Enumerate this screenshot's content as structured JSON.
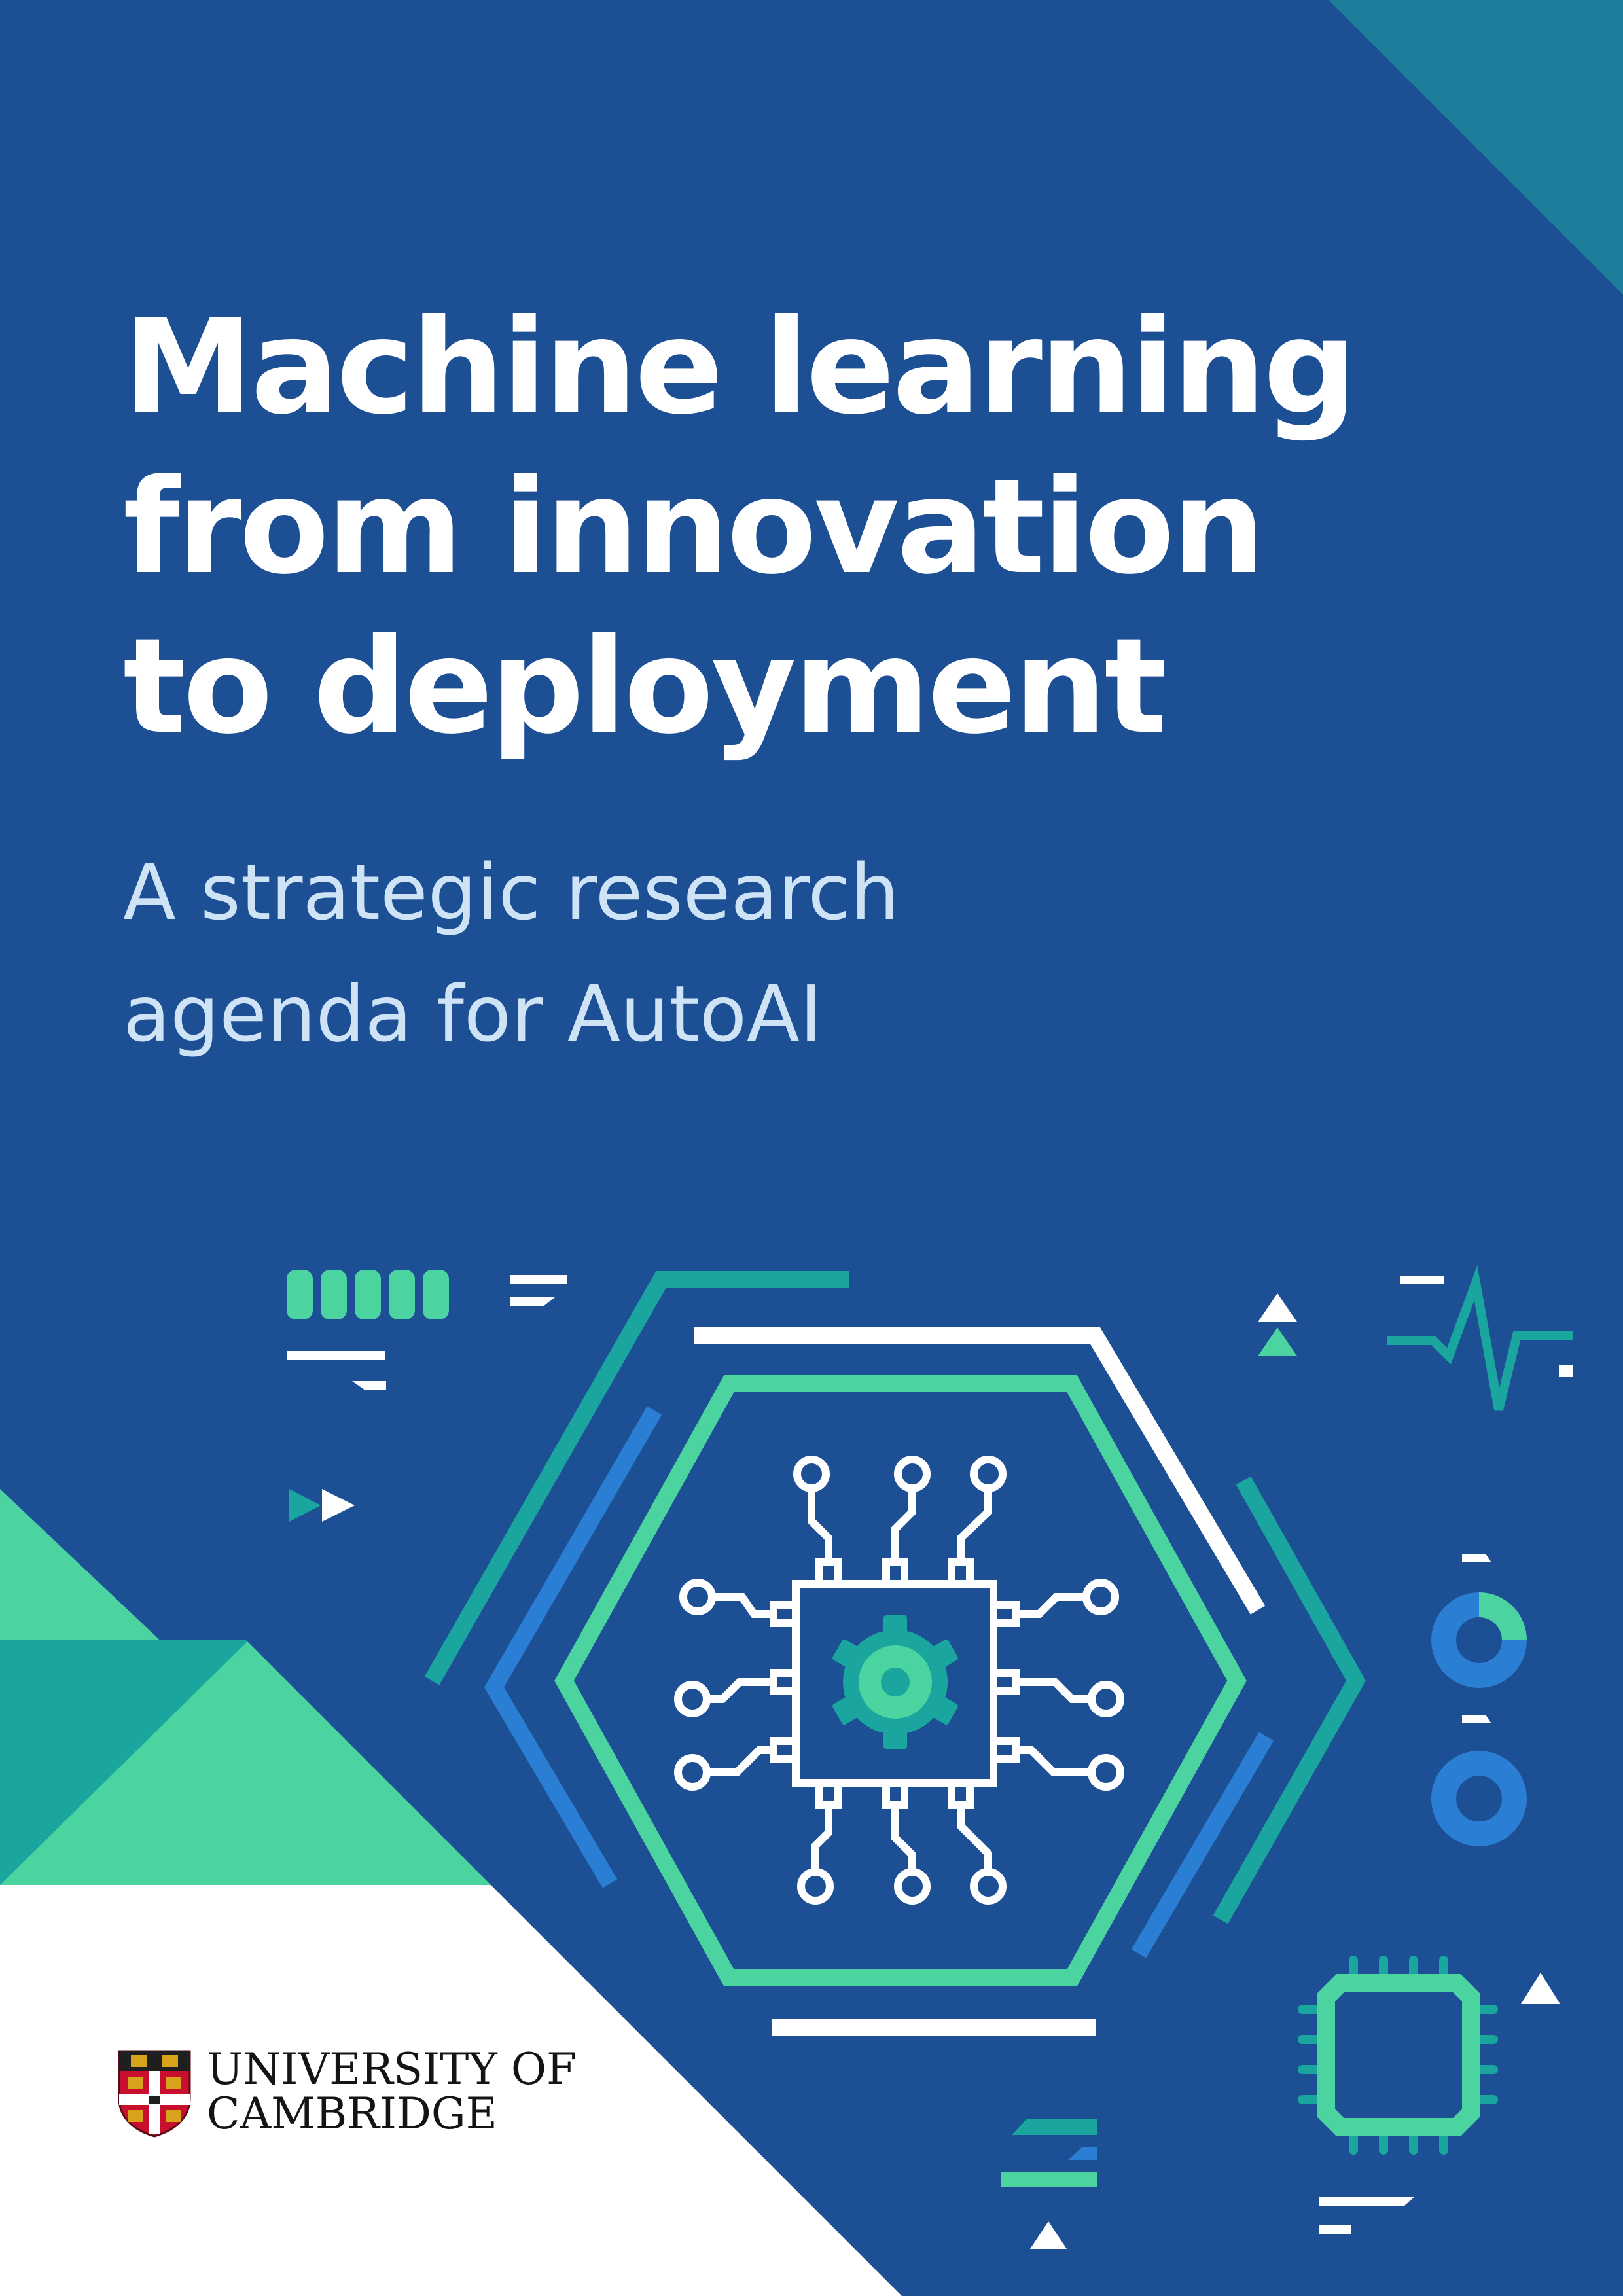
{
  "cover": {
    "title_lines": [
      "Machine learning",
      "from innovation",
      "to deployment"
    ],
    "subtitle_lines": [
      "A strategic research",
      "agenda for AutoAI"
    ]
  },
  "logo": {
    "line1": "UNIVERSITY OF",
    "line2": "CAMBRIDGE",
    "crest": "university-crest-shield"
  },
  "colors": {
    "background": "#1c4f94",
    "teal": "#1c9c9f",
    "mint": "#4bd4a0",
    "blue": "#2a7fd4",
    "white": "#ffffff",
    "subtitle": "#cfe3f6"
  },
  "illustration": {
    "centerpiece": "hexagon-chip-gear-icon"
  }
}
